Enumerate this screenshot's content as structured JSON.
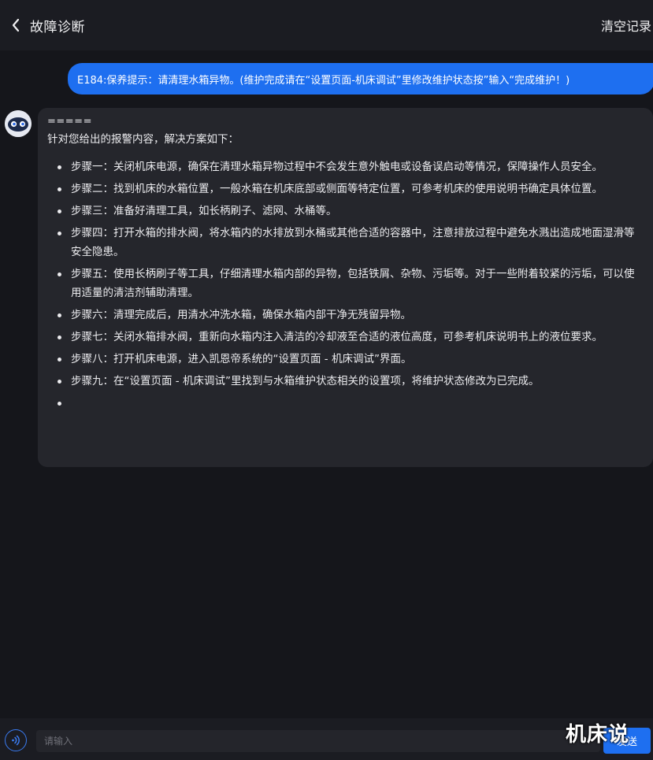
{
  "header": {
    "title": "故障诊断",
    "clear_label": "清空记录",
    "back_icon": "chevron-left-icon"
  },
  "user_message": {
    "text": "E184:保养提示：请清理水箱异物。(维护完成请在“设置页面-机床调试”里修改维护状态按”输入“完成维护！)"
  },
  "bot_message": {
    "separator": "=====",
    "intro": "针对您给出的报警内容，解决方案如下：",
    "steps": [
      "步骤一：关闭机床电源，确保在清理水箱异物过程中不会发生意外触电或设备误启动等情况，保障操作人员安全。",
      "步骤二：找到机床的水箱位置，一般水箱在机床底部或侧面等特定位置，可参考机床的使用说明书确定具体位置。",
      "步骤三：准备好清理工具，如长柄刷子、滤网、水桶等。",
      "步骤四：打开水箱的排水阀，将水箱内的水排放到水桶或其他合适的容器中，注意排放过程中避免水溅出造成地面湿滑等安全隐患。",
      "步骤五：使用长柄刷子等工具，仔细清理水箱内部的异物，包括铁屑、杂物、污垢等。对于一些附着较紧的污垢，可以使用适量的清洁剂辅助清理。",
      "步骤六：清理完成后，用清水冲洗水箱，确保水箱内部干净无残留异物。",
      "步骤七：关闭水箱排水阀，重新向水箱内注入清洁的冷却液至合适的液位高度，可参考机床说明书上的液位要求。",
      "步骤八：打开机床电源，进入凯恩帝系统的“设置页面 - 机床调试”界面。",
      "步骤九：在“设置页面 - 机床调试”里找到与水箱维护状态相关的设置项，将维护状态修改为已完成。",
      ""
    ]
  },
  "input_bar": {
    "placeholder": "请输入",
    "send_label": "发送",
    "voice_icon": "voice-icon"
  },
  "watermark": "机床说",
  "colors": {
    "background": "#15161b",
    "header": "#1b1c22",
    "accent": "#1e6ff0",
    "bot_bubble": "#25262c"
  }
}
